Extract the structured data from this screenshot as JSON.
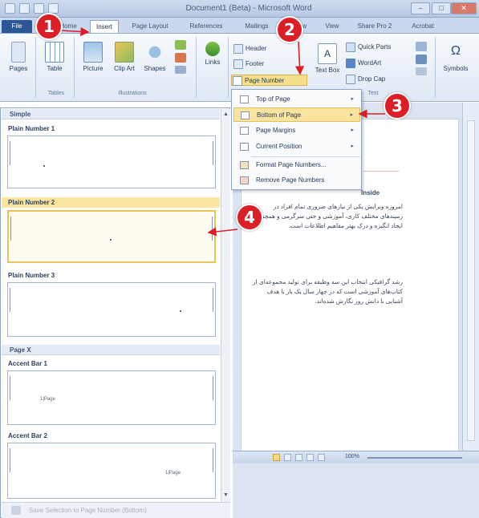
{
  "window": {
    "title": "Document1 (Beta) - Microsoft Word",
    "buttons": {
      "minimize": "–",
      "maximize": "□",
      "close": "✕"
    }
  },
  "tabs": [
    "File",
    "Home",
    "Insert",
    "Page Layout",
    "References",
    "Mailings",
    "Review",
    "View",
    "Share Pro 2",
    "Acrobat"
  ],
  "ribbon": {
    "pages": "Pages",
    "table": "Table",
    "picture": "Picture",
    "clip_art": "Clip Art",
    "shapes": "Shapes",
    "links": "Links",
    "header": "Header",
    "footer": "Footer",
    "page_number": "Page Number",
    "text_box": "Text Box",
    "quick_parts": "Quick Parts",
    "wordart": "WordArt",
    "drop_cap": "Drop Cap",
    "symbols": "Symbols",
    "groups": {
      "tables": "Tables",
      "illustrations": "Illustrations",
      "text": "Text"
    }
  },
  "menu": {
    "items": [
      {
        "label": "Top of Page"
      },
      {
        "label": "Bottom of Page"
      },
      {
        "label": "Page Margins"
      },
      {
        "label": "Current Position"
      },
      {
        "label": "Format Page Numbers..."
      },
      {
        "label": "Remove Page Numbers"
      }
    ],
    "submenu_arrow": "▸"
  },
  "gallery": {
    "category_simple": "Simple",
    "category_page_x": "Page X",
    "items": [
      {
        "label": "Plain Number 1"
      },
      {
        "label": "Plain Number 2"
      },
      {
        "label": "Plain Number 3"
      },
      {
        "label": "Accent Bar 1",
        "sample": "1|Page"
      },
      {
        "label": "Accent Bar 2",
        "sample": "1|Page"
      }
    ],
    "footer_label": "Save Selection to Page Number (Bottom)"
  },
  "document": {
    "title": "Inside",
    "paragraph1": "امروزه ویرایش یکی از نیازهای ضروری تمام افراد در زمینه‌های مختلف کاری، آموزشی و حتی سرگرمی و همچنین ایجاد انگیزه و درک بهتر مفاهیم اطلاعات است.",
    "paragraph2": "رشد گرافیکی انتخاب این سه وظیفه برای تولید مجموعه‌ای از کتاب‌های آموزشی است که در چهار سال یک بار با هدف آشنایی با دانش روز نگارش شده‌اند."
  },
  "statusbar": {
    "zoom": "100%"
  },
  "callouts": [
    "1",
    "2",
    "3",
    "4"
  ],
  "colors": {
    "callout": "#dc1f26",
    "highlight": "#fbe4a0",
    "file_tab": "#2b5797"
  }
}
